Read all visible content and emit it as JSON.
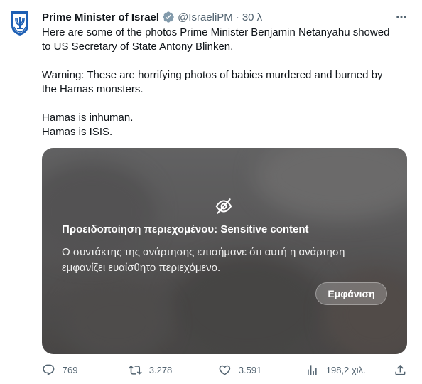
{
  "author": {
    "name": "Prime Minister of Israel",
    "handle": "@IsraeliPM",
    "separator": "·",
    "time": "30 λ"
  },
  "icons": {
    "avatar": "israel-emblem-icon",
    "verified": "verified-badge-icon",
    "more": "more-icon",
    "sensitive": "eye-off-icon",
    "reply": "reply-icon",
    "retweet": "retweet-icon",
    "like": "heart-icon",
    "views": "views-icon",
    "share": "share-icon"
  },
  "tweet": {
    "line1": "Here are some of the photos Prime Minister Benjamin Netanyahu showed",
    "line2": "to US Secretary of State Antony Blinken.",
    "line3": "Warning: These are horrifying photos of babies murdered and burned by",
    "line4": "the Hamas monsters.",
    "line5": "Hamas is inhuman.",
    "line6": "Hamas is ISIS."
  },
  "media_warning": {
    "title": "Προειδοποίηση περιεχομένου: Sensitive content",
    "description": "Ο συντάκτης της ανάρτησης επισήμανε ότι αυτή η ανάρτηση εμφανίζει ευαίσθητο περιεχόμενο.",
    "show_button": "Εμφάνιση"
  },
  "actions": {
    "replies": "769",
    "retweets": "3.278",
    "likes": "3.591",
    "views": "198,2 χιλ."
  },
  "colors": {
    "text_primary": "#0f1419",
    "text_secondary": "#536471",
    "verified_badge": "#829aab",
    "emblem_blue": "#1d5fb4"
  }
}
